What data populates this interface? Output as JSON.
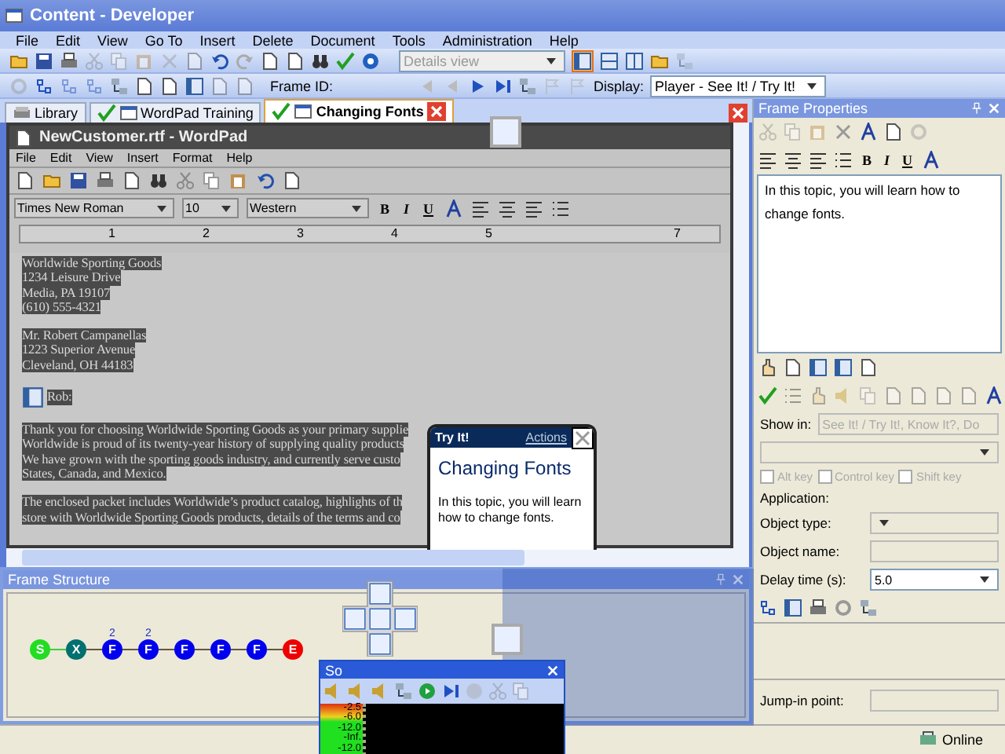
{
  "window": {
    "title": "Content - Developer"
  },
  "menu": [
    "File",
    "Edit",
    "View",
    "Go To",
    "Insert",
    "Delete",
    "Document",
    "Tools",
    "Administration",
    "Help"
  ],
  "toolbar": {
    "view_select": {
      "value": "Details view",
      "disabled": true
    },
    "frame_id_label": "Frame ID:",
    "display_label": "Display:",
    "display_select": {
      "value": "Player - See It! / Try It!"
    }
  },
  "tabs": [
    {
      "label": "Library",
      "selected": false,
      "checked": false
    },
    {
      "label": "WordPad Training",
      "selected": false,
      "checked": true
    },
    {
      "label": "Changing Fonts",
      "selected": true,
      "checked": true
    }
  ],
  "wordpad": {
    "title": "NewCustomer.rtf - WordPad",
    "menu": [
      "File",
      "Edit",
      "View",
      "Insert",
      "Format",
      "Help"
    ],
    "font": "Times New Roman",
    "size": "10",
    "script": "Western",
    "format_buttons": [
      "B",
      "I",
      "U"
    ],
    "ruler": [
      "1",
      "2",
      "3",
      "4",
      "5",
      "7"
    ],
    "paragraphs": [
      [
        "Worldwide Sporting Goods",
        "1234 Leisure Drive",
        "Media, PA 19107",
        "(610) 555-4321"
      ],
      [
        "Mr. Robert Campanellas",
        "1223 Superior Avenue",
        "Cleveland, OH  44183"
      ],
      [
        "Rob:"
      ],
      [
        "Thank you for choosing Worldwide Sporting Goods as your primary supplie",
        "Worldwide is proud of its twenty-year history of supplying quality products",
        "We have grown with the sporting goods industry, and currently serve custo",
        "States, Canada, and Mexico."
      ],
      [
        "The enclosed packet includes Worldwide’s product catalog, highlights of th",
        "store with Worldwide Sporting Goods products, details of the terms and co"
      ]
    ]
  },
  "tryit_bubble": {
    "header": "Try It!",
    "link": "Actions",
    "title": "Changing Fonts",
    "body": "In this topic, you will learn how to change fonts."
  },
  "frame_structure": {
    "title": "Frame Structure",
    "nodes": [
      {
        "label": "S",
        "color": "#22dd22"
      },
      {
        "label": "X",
        "color": "#007070"
      },
      {
        "label": "F",
        "color": "#0000ee",
        "badge": "2"
      },
      {
        "label": "F",
        "color": "#0000ee",
        "badge": "2"
      },
      {
        "label": "F",
        "color": "#0000ee"
      },
      {
        "label": "F",
        "color": "#0000ee"
      },
      {
        "label": "F",
        "color": "#0000ee"
      },
      {
        "label": "E",
        "color": "#ee0000"
      }
    ]
  },
  "sound_window": {
    "title": "So",
    "levels": [
      "-2.5",
      "-6.0",
      "-12.0",
      "-Inf.",
      "-12.0"
    ]
  },
  "frame_properties": {
    "title": "Frame Properties",
    "format_buttons": [
      "B",
      "I",
      "U"
    ],
    "text": "In this topic, you will learn how to change fonts.",
    "show_in_label": "Show in:",
    "show_in_value": "See It! / Try It!, Know It?, Do",
    "keys": [
      {
        "label": "Alt key",
        "checked": false,
        "disabled": true
      },
      {
        "label": "Control key",
        "checked": false,
        "disabled": true
      },
      {
        "label": "Shift key",
        "checked": false,
        "disabled": true
      }
    ],
    "application_label": "Application:",
    "object_type_label": "Object type:",
    "object_name_label": "Object name:",
    "delay_label": "Delay time (s):",
    "delay_value": "5.0",
    "jump_in_label": "Jump-in point:"
  },
  "status_bar": {
    "status": "Online"
  }
}
